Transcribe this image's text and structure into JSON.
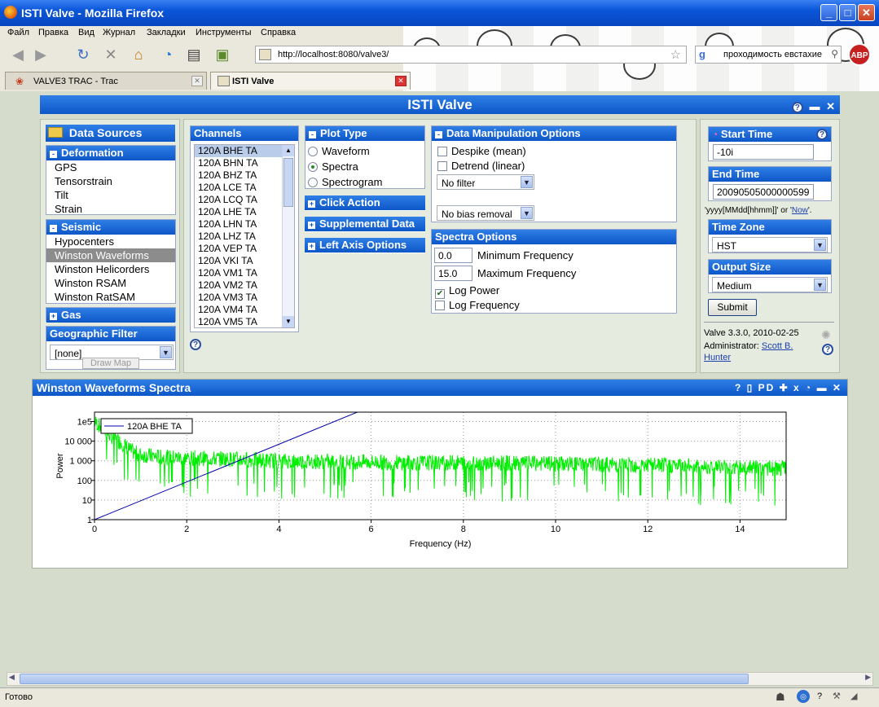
{
  "window": {
    "title": "ISTI Valve - Mozilla Firefox"
  },
  "menu": [
    "Файл",
    "Правка",
    "Вид",
    "Журнал",
    "Закладки",
    "Инструменты",
    "Справка"
  ],
  "nav": {
    "url": "http://localhost:8080/valve3/",
    "search_text": "проходимость евстахие",
    "abp": "ABP"
  },
  "tabs": [
    {
      "label": "VALVE3 TRAC - Trac"
    },
    {
      "label": "ISTI Valve"
    }
  ],
  "app": {
    "title": "ISTI Valve"
  },
  "data_sources": {
    "title": "Data Sources",
    "deformation": {
      "label": "Deformation",
      "items": [
        "GPS",
        "Tensorstrain",
        "Tilt",
        "Strain"
      ]
    },
    "seismic": {
      "label": "Seismic",
      "items": [
        "Hypocenters",
        "Winston Waveforms",
        "Winston Helicorders",
        "Winston RSAM",
        "Winston RatSAM"
      ],
      "selected": "Winston Waveforms"
    },
    "gas": {
      "label": "Gas"
    },
    "geo_filter": {
      "label": "Geographic Filter",
      "value": "[none]",
      "button": "Draw Map"
    }
  },
  "channels": {
    "title": "Channels",
    "items": [
      "120A BHE TA",
      "120A BHN TA",
      "120A BHZ TA",
      "120A LCE TA",
      "120A LCQ TA",
      "120A LHE TA",
      "120A LHN TA",
      "120A LHZ TA",
      "120A VEP TA",
      "120A VKI TA",
      "120A VM1 TA",
      "120A VM2 TA",
      "120A VM3 TA",
      "120A VM4 TA",
      "120A VM5 TA"
    ],
    "selected": "120A BHE TA"
  },
  "plot_type": {
    "title": "Plot Type",
    "options": [
      "Waveform",
      "Spectra",
      "Spectrogram"
    ],
    "selected": "Spectra"
  },
  "collapsed": {
    "click_action": "Click Action",
    "supplemental": "Supplemental Data",
    "left_axis": "Left Axis Options"
  },
  "data_manip": {
    "title": "Data Manipulation Options",
    "despike": "Despike (mean)",
    "detrend": "Detrend (linear)",
    "filter": "No filter",
    "bias": "No bias removal"
  },
  "spectra_opts": {
    "title": "Spectra Options",
    "min_freq": {
      "value": "0.0",
      "label": "Minimum Frequency"
    },
    "max_freq": {
      "value": "15.0",
      "label": "Maximum Frequency"
    },
    "log_power": {
      "label": "Log Power",
      "checked": true
    },
    "log_freq": {
      "label": "Log Frequency",
      "checked": false
    }
  },
  "time": {
    "start_label": "Start Time",
    "start_value": "-10i",
    "end_label": "End Time",
    "end_value": "20090505000000599",
    "format_hint_a": "'yyyy[MMdd[hhmm]]' or '",
    "format_hint_now": "Now",
    "format_hint_b": "'.",
    "tz_label": "Time Zone",
    "tz_value": "HST",
    "size_label": "Output Size",
    "size_value": "Medium",
    "submit": "Submit"
  },
  "footer": {
    "version": "Valve 3.3.0, 2010-02-25",
    "admin_label": "Administrator:",
    "admin_name": "Scott B. Hunter"
  },
  "plot": {
    "title": "Winston Waveforms Spectra",
    "toolbar": "? ▯ PD ✚ x ◔ ▬ ✕"
  },
  "chart_data": {
    "type": "line",
    "xlabel": "Frequency (Hz)",
    "ylabel": "Power",
    "xlim": [
      0,
      15
    ],
    "ylim": [
      1,
      300000
    ],
    "y_scale": "log",
    "x_ticks": [
      0,
      2,
      4,
      6,
      8,
      10,
      12,
      14
    ],
    "y_tick_labels": [
      "1",
      "10",
      "100",
      "1 000",
      "10 000",
      "1e5"
    ],
    "grid": true,
    "legend_position": "top-left",
    "series": [
      {
        "name": "120A BHE TA",
        "color": "#00ee00",
        "x": [
          0,
          0.2,
          0.4,
          0.6,
          0.8,
          1,
          1.5,
          2,
          3,
          4,
          5,
          6,
          7,
          8,
          9,
          10,
          11,
          12,
          13,
          14,
          15
        ],
        "values": [
          100000,
          40000,
          15000,
          8000,
          3000,
          2000,
          1500,
          1400,
          1200,
          1000,
          900,
          850,
          800,
          800,
          750,
          700,
          650,
          600,
          550,
          450,
          400
        ]
      },
      {
        "name": "",
        "color": "#0000aa",
        "x": [
          0,
          5.7
        ],
        "values": [
          1,
          300000
        ]
      }
    ]
  },
  "status": {
    "text": "Готово"
  }
}
